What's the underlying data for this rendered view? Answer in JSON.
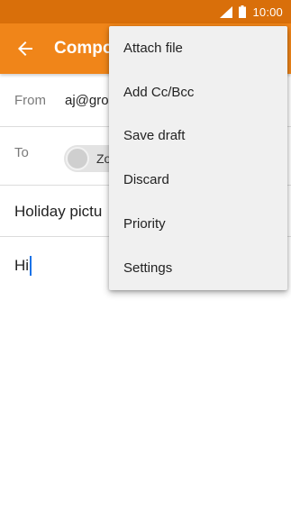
{
  "status_bar": {
    "time": "10:00",
    "icons": [
      "signal-icon",
      "battery-icon"
    ]
  },
  "app_bar": {
    "title": "Compose",
    "back_icon": "back-arrow-icon"
  },
  "compose": {
    "from_label": "From",
    "from_value": "aj@gro",
    "to_label": "To",
    "to_chip_text": "Zo",
    "subject": "Holiday pictu",
    "body": "Hi"
  },
  "menu": {
    "items": [
      {
        "label": "Attach file"
      },
      {
        "label": "Add Cc/Bcc"
      },
      {
        "label": "Save draft"
      },
      {
        "label": "Discard"
      },
      {
        "label": "Priority"
      },
      {
        "label": "Settings"
      }
    ]
  },
  "colors": {
    "status_bar": "#d96f0a",
    "app_bar": "#f08519",
    "menu_bg": "#f0f0f0",
    "cursor": "#1a73e8"
  }
}
